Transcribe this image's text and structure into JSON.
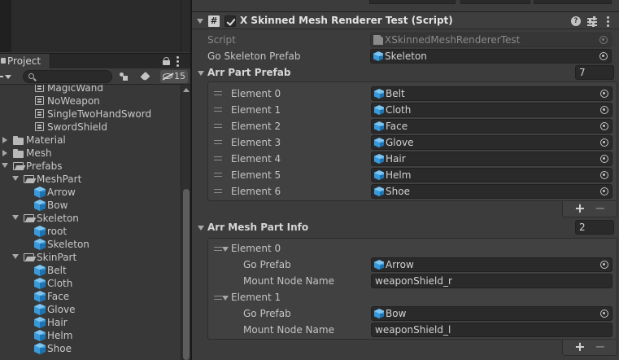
{
  "project": {
    "tab_label": "Project",
    "search": {
      "value": "",
      "placeholder": ""
    },
    "hidden_count": "15",
    "tree": [
      {
        "label": "MagicWand",
        "icon": "animator-controller-icon"
      },
      {
        "label": "NoWeapon",
        "icon": "animator-controller-icon"
      },
      {
        "label": "SingleTwoHandSword",
        "icon": "animator-controller-icon"
      },
      {
        "label": "SwordShield",
        "icon": "animator-controller-icon"
      },
      {
        "label": "Material",
        "icon": "folder-icon",
        "state": "collapsed"
      },
      {
        "label": "Mesh",
        "icon": "folder-icon",
        "state": "collapsed"
      },
      {
        "label": "Prefabs",
        "icon": "folder-open-icon",
        "state": "expanded"
      },
      {
        "label": "MeshPart",
        "icon": "folder-open-icon",
        "state": "expanded"
      },
      {
        "label": "Arrow",
        "icon": "prefab-icon"
      },
      {
        "label": "Bow",
        "icon": "prefab-icon"
      },
      {
        "label": "Skeleton",
        "icon": "folder-open-icon",
        "state": "expanded"
      },
      {
        "label": "root",
        "icon": "prefab-icon"
      },
      {
        "label": "Skeleton",
        "icon": "prefab-icon"
      },
      {
        "label": "SkinPart",
        "icon": "folder-open-icon",
        "state": "expanded"
      },
      {
        "label": "Belt",
        "icon": "prefab-icon"
      },
      {
        "label": "Cloth",
        "icon": "prefab-icon"
      },
      {
        "label": "Face",
        "icon": "prefab-icon"
      },
      {
        "label": "Glove",
        "icon": "prefab-icon"
      },
      {
        "label": "Hair",
        "icon": "prefab-icon"
      },
      {
        "label": "Helm",
        "icon": "prefab-icon"
      },
      {
        "label": "Shoe",
        "icon": "prefab-icon"
      }
    ]
  },
  "inspector": {
    "component": {
      "icon": "cs-script-icon",
      "icon_glyph": "#",
      "enabled": true,
      "title": "X Skinned Mesh Renderer Test (Script)"
    },
    "script": {
      "label": "Script",
      "value": "XSkinnedMeshRendererTest"
    },
    "go_skeleton_prefab": {
      "label": "Go Skeleton Prefab",
      "value": "Skeleton"
    },
    "arr_part_prefab": {
      "label": "Arr Part Prefab",
      "count": "7",
      "elements": [
        {
          "label": "Element 0",
          "value": "Belt"
        },
        {
          "label": "Element 1",
          "value": "Cloth"
        },
        {
          "label": "Element 2",
          "value": "Face"
        },
        {
          "label": "Element 3",
          "value": "Glove"
        },
        {
          "label": "Element 4",
          "value": "Hair"
        },
        {
          "label": "Element 5",
          "value": "Helm"
        },
        {
          "label": "Element 6",
          "value": "Shoe"
        }
      ],
      "add_label": "+",
      "remove_label": "−"
    },
    "arr_mesh_part_info": {
      "label": "Arr Mesh Part Info",
      "count": "2",
      "elements": [
        {
          "label": "Element 0",
          "go_prefab_label": "Go Prefab",
          "go_prefab_value": "Arrow",
          "mount_node_label": "Mount Node Name",
          "mount_node_value": "weaponShield_r"
        },
        {
          "label": "Element 1",
          "go_prefab_label": "Go Prefab",
          "go_prefab_value": "Bow",
          "mount_node_label": "Mount Node Name",
          "mount_node_value": "weaponShield_l"
        }
      ],
      "add_label": "+",
      "remove_label": "−"
    }
  },
  "colors": {
    "panel_bg": "#383838",
    "inspector_bg": "#3c3c3c",
    "field_bg": "#2a2a2a",
    "prefab_blue": "#3a9ad9",
    "text": "#c8c8c8"
  }
}
